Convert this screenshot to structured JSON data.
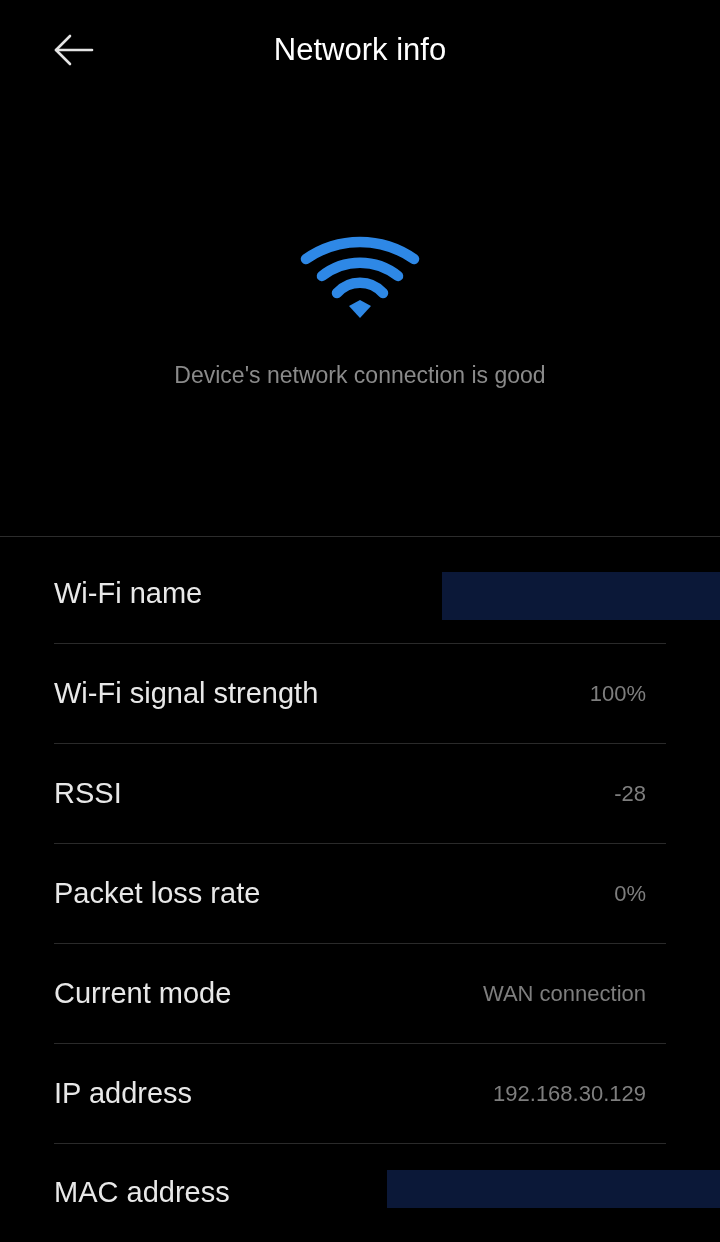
{
  "header": {
    "title": "Network info"
  },
  "status": {
    "message": "Device's network connection is good"
  },
  "rows": [
    {
      "label": "Wi-Fi name",
      "kind": "redacted"
    },
    {
      "label": "Wi-Fi signal strength",
      "kind": "value",
      "value": "100%"
    },
    {
      "label": "RSSI",
      "kind": "value",
      "value": "-28"
    },
    {
      "label": "Packet loss rate",
      "kind": "value",
      "value": "0%"
    },
    {
      "label": "Current mode",
      "kind": "value",
      "value": "WAN connection"
    },
    {
      "label": "IP address",
      "kind": "value",
      "value": "192.168.30.129"
    },
    {
      "label": "MAC address",
      "kind": "redacted"
    }
  ]
}
